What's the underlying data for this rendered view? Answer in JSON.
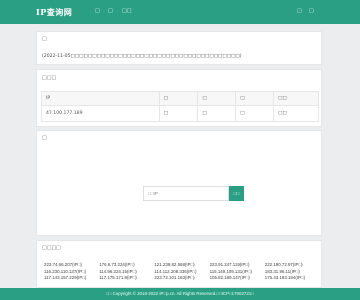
{
  "header": {
    "logo": "IP查询网",
    "nav": [
      "□",
      "□",
      "□□"
    ],
    "nav_right": [
      "□",
      "□"
    ]
  },
  "info_card": {
    "title": "□",
    "text": "(2022-11-05□□□□□□□□□□□□□□□□□□□□□□□□□□□□□□□□□□□□□□□)"
  },
  "ip_table": {
    "title": "□□□",
    "headers": [
      "IP",
      "□",
      "□",
      "□",
      "□□"
    ],
    "row": [
      "47.100.177.189",
      "□",
      "□",
      "□",
      "□□"
    ]
  },
  "search": {
    "title": "□",
    "placeholder": "□□IP",
    "button_label": "□□"
  },
  "recent": {
    "title": "□□□□",
    "ips": [
      "223.74.66.207(IP□)",
      "176.6.73.224(IP□)",
      "121.239.82.568(IP□)",
      "223.91.247.119(IP□)",
      "222.190.72.97(IP□)",
      "116.230.110.137(IP□)",
      "114.96.224.15(IP□)",
      "114.112.208.336(IP□)",
      "115.149.109.131(IP□)",
      "183.31.96.11(IP□)",
      "117.143.157.229(IP□)",
      "117.175.171.8(IP□)",
      "223.72.101.163(IP□)",
      "105.82.189.147(IP□)",
      "175.43.183.184(IP□)"
    ]
  },
  "footer": {
    "text": "□□ Copyright © 2018-2022 IP□p.cn. All Rights Reserved.□□ICP□17002721□"
  }
}
